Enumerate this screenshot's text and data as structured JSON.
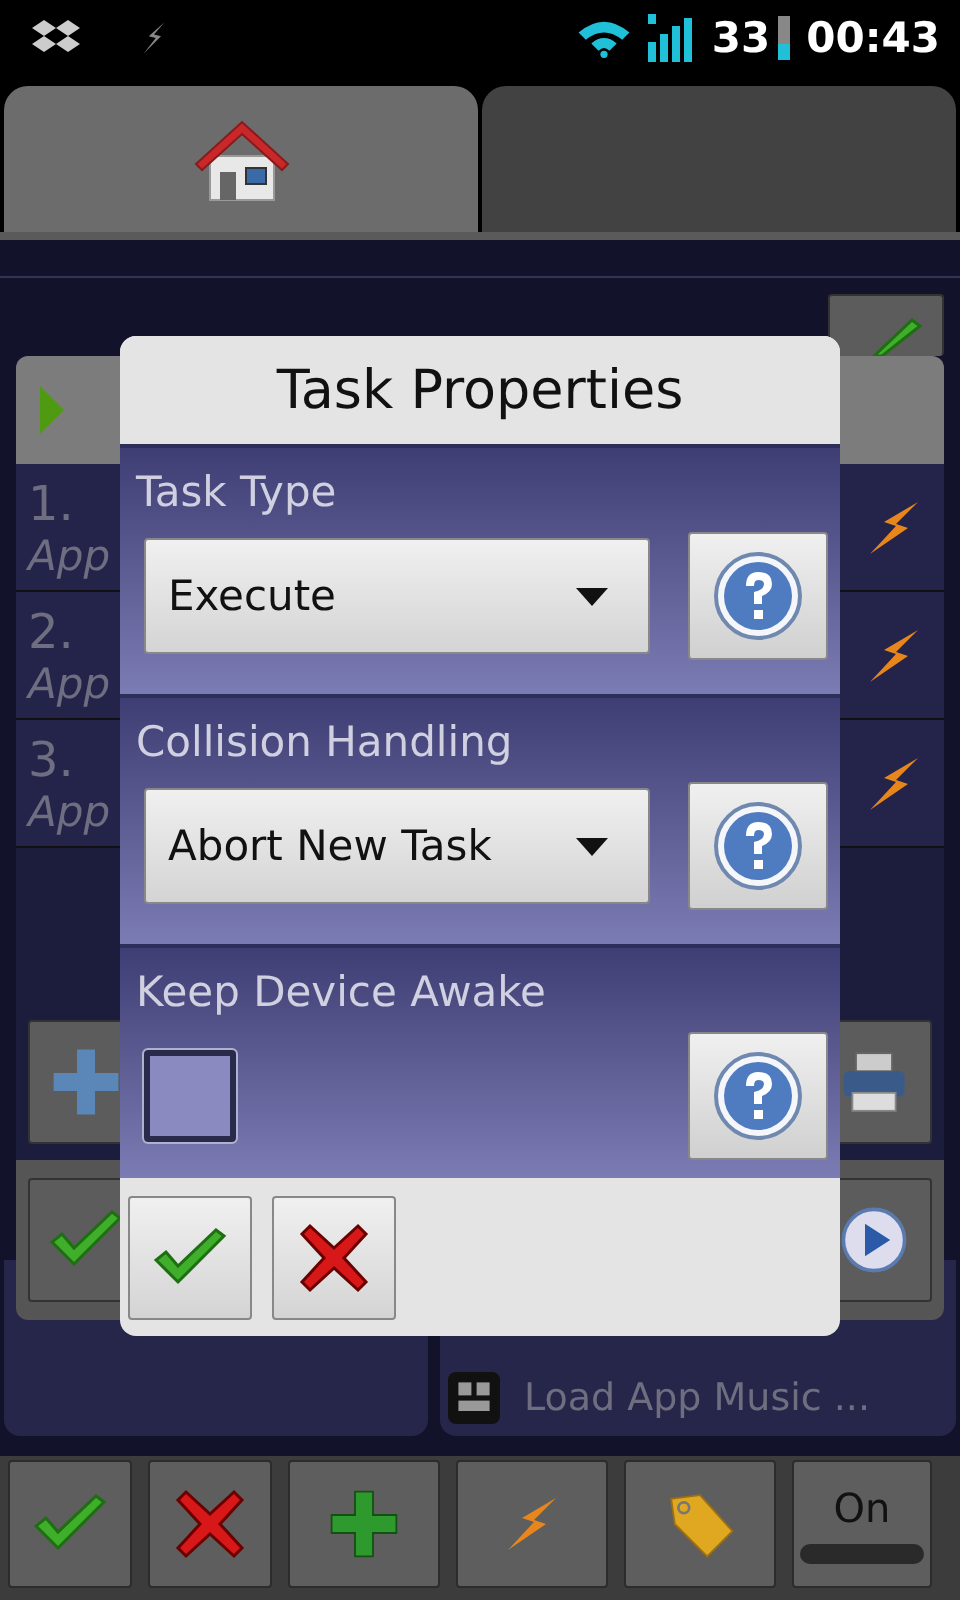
{
  "status_bar": {
    "battery": "33",
    "time": "00:43"
  },
  "tabs": [
    {
      "kind": "home",
      "selected": true
    },
    {
      "kind": "empty",
      "selected": false
    }
  ],
  "background": {
    "rows": [
      {
        "number": "1.",
        "subtitle": "App"
      },
      {
        "number": "2.",
        "subtitle": "App"
      },
      {
        "number": "3.",
        "subtitle": "App"
      }
    ],
    "actions": [
      "Load App Music ..."
    ]
  },
  "dialog": {
    "title": "Task Properties",
    "fields": [
      {
        "kind": "dropdown",
        "label": "Task Type",
        "value": "Execute"
      },
      {
        "kind": "dropdown",
        "label": "Collision Handling",
        "value": "Abort New Task"
      },
      {
        "kind": "checkbox",
        "label": "Keep Device Awake",
        "checked": false
      }
    ]
  },
  "toolbar": {
    "toggle": {
      "label": "On",
      "on": false
    }
  }
}
